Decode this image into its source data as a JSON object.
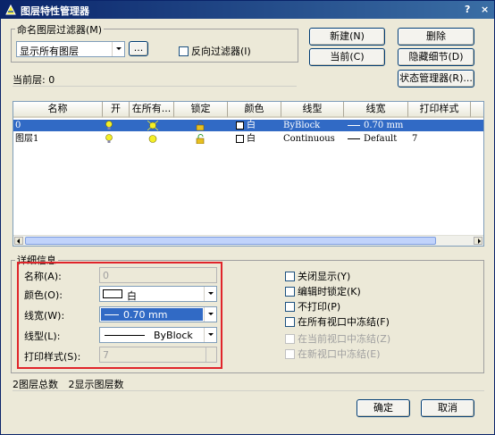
{
  "window": {
    "title": "图层特性管理器",
    "help": "?",
    "close": "×"
  },
  "filter": {
    "group_title": "命名图层过滤器(M)",
    "selected": "显示所有图层",
    "browse": "...",
    "invert_label": "反向过滤器(I)"
  },
  "buttons": {
    "new": "新建(N)",
    "delete": "删除",
    "current": "当前(C)",
    "hide_details": "隐藏细节(D)",
    "state_manager": "状态管理器(R)..."
  },
  "current_layer": {
    "label": "当前层:",
    "value": "0"
  },
  "table": {
    "columns": [
      "名称",
      "开",
      "在所有...",
      "锁定",
      "颜色",
      "线型",
      "线宽",
      "打印样式"
    ],
    "rows": [
      {
        "name": "0",
        "color": "白",
        "linetype": "ByBlock",
        "lineweight": "0.70 mm",
        "plot_style": "",
        "selected": true
      },
      {
        "name": "图层1",
        "color": "白",
        "linetype": "Continuous",
        "lineweight": "Default",
        "plot_style": "7",
        "selected": false
      }
    ]
  },
  "details": {
    "group_title": "详细信息",
    "name_label": "名称(A):",
    "name_value": "0",
    "color_label": "颜色(O):",
    "color_value": "白",
    "lineweight_label": "线宽(W):",
    "lineweight_value": "0.70 mm",
    "linetype_label": "线型(L):",
    "linetype_value": "ByBlock",
    "plotstyle_label": "打印样式(S):",
    "plotstyle_value": "7"
  },
  "options": {
    "off": "关闭显示(Y)",
    "lock_edit": "编辑时锁定(K)",
    "no_plot": "不打印(P)",
    "freeze_all": "在所有视口中冻结(F)",
    "freeze_current": "在当前视口中冻结(Z)",
    "freeze_new": "在新视口中冻结(E)"
  },
  "status": {
    "total": "2图层总数",
    "shown": "2显示图层数"
  },
  "footer": {
    "ok": "确定",
    "cancel": "取消"
  },
  "colors": {
    "selection": "#316ac5",
    "highlight_box": "#e0242a",
    "titlebar": "#0a246a",
    "bulb": "#f4ef26"
  }
}
